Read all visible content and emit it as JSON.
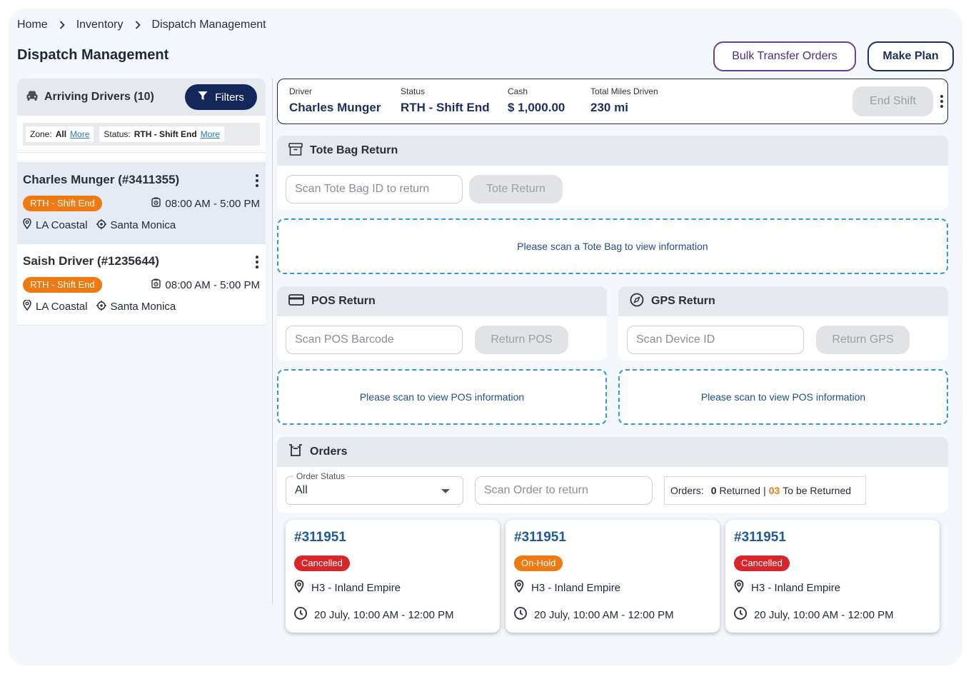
{
  "breadcrumb": {
    "items": [
      "Home",
      "Inventory",
      "Dispatch Management"
    ]
  },
  "page": {
    "title": "Dispatch Management",
    "bulk_transfer_label": "Bulk Transfer Orders",
    "make_plan_label": "Make Plan"
  },
  "sidebar": {
    "title": "Arriving Drivers (10)",
    "filters_label": "Filters",
    "chips": [
      {
        "label": "Zone:",
        "value": "All",
        "more": "More"
      },
      {
        "label": "Status:",
        "value": "RTH - Shift End",
        "more": "More"
      }
    ],
    "drivers": [
      {
        "name": "Charles Munger (#3411355)",
        "status": "RTH - Shift End",
        "time": "08:00 AM - 5:00 PM",
        "location": "LA Coastal",
        "area": "Santa Monica"
      },
      {
        "name": "Saish Driver (#1235644)",
        "status": "RTH - Shift End",
        "time": "08:00 AM - 5:00 PM",
        "location": "LA Coastal",
        "area": "Santa Monica"
      }
    ]
  },
  "driver_info": {
    "driver_label": "Driver",
    "driver_value": "Charles Munger",
    "status_label": "Status",
    "status_value": "RTH - Shift End",
    "cash_label": "Cash",
    "cash_value": "$ 1,000.00",
    "miles_label": "Total Miles Driven",
    "miles_value": "230 mi",
    "end_shift_label": "End Shift"
  },
  "tote": {
    "title": "Tote Bag Return",
    "placeholder": "Scan Tote Bag ID to return",
    "button": "Tote Return",
    "message": "Please scan a Tote Bag to view information"
  },
  "pos": {
    "title": "POS Return",
    "placeholder": "Scan POS Barcode",
    "button": "Return POS",
    "message": "Please scan to view POS information"
  },
  "gps": {
    "title": "GPS Return",
    "placeholder": "Scan Device ID",
    "button": "Return GPS",
    "message": "Please scan to view POS information"
  },
  "orders": {
    "title": "Orders",
    "status_legend": "Order Status",
    "status_value": "All",
    "scan_placeholder": "Scan Order to return",
    "counts_label": "Orders:",
    "returned_count": "0",
    "returned_label": "Returned",
    "separator": "|",
    "to_return_count": "03",
    "to_return_label": "To be Returned",
    "cards": [
      {
        "id": "#311951",
        "status": "Cancelled",
        "status_color": "#d8262a",
        "location": "H3 - Inland Empire",
        "time": "20 July, 10:00 AM - 12:00 PM"
      },
      {
        "id": "#311951",
        "status": "On-Hold",
        "status_color": "#f07a12",
        "location": "H3 - Inland Empire",
        "time": "20 July, 10:00 AM - 12:00 PM"
      },
      {
        "id": "#311951",
        "status": "Cancelled",
        "status_color": "#d8262a",
        "location": "H3 - Inland Empire",
        "time": "20 July, 10:00 AM - 12:00 PM"
      }
    ]
  },
  "colors": {
    "primary": "#14275a",
    "accent_purple": "#6b3fa0",
    "status_orange": "#f07a12",
    "status_red": "#d8262a",
    "dashed_border": "#2e9bd6"
  }
}
